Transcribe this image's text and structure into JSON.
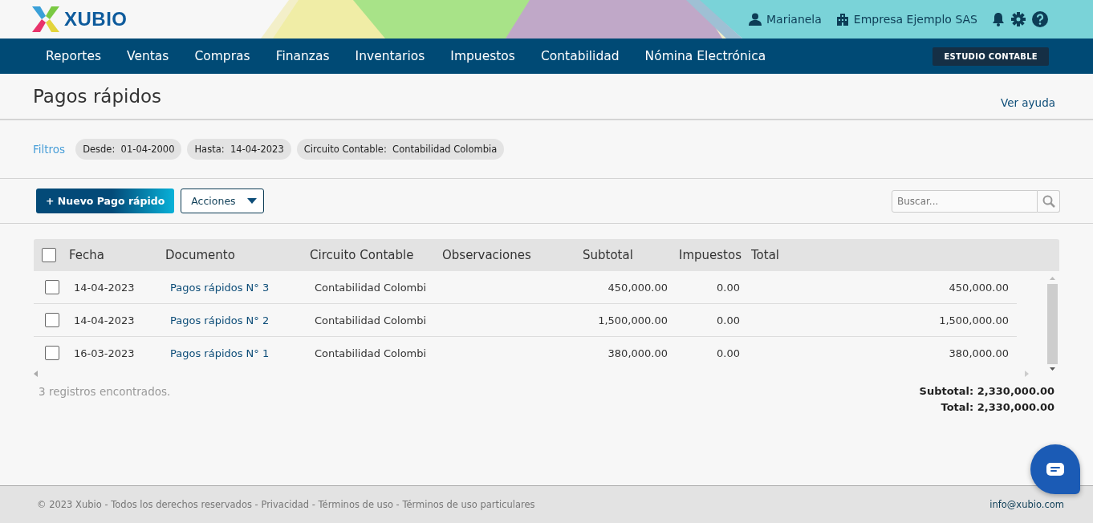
{
  "header": {
    "logo": "XUBIO",
    "user": "Marianela",
    "company": "Empresa Ejemplo SAS"
  },
  "nav": {
    "items": [
      "Reportes",
      "Ventas",
      "Compras",
      "Finanzas",
      "Inventarios",
      "Impuestos",
      "Contabilidad",
      "Nómina Electrónica"
    ],
    "badge": "ESTUDIO CONTABLE"
  },
  "page": {
    "title": "Pagos rápidos",
    "help_link": "Ver ayuda"
  },
  "filters": {
    "label": "Filtros",
    "chips": [
      {
        "name": "Desde:",
        "value": "01-04-2000"
      },
      {
        "name": "Hasta:",
        "value": "14-04-2023"
      },
      {
        "name": "Circuito Contable:",
        "value": "Contabilidad Colombia"
      }
    ]
  },
  "toolbar": {
    "new_button": "+ Nuevo Pago rápido",
    "actions_button": "Acciones",
    "search": {
      "placeholder": "Buscar..."
    }
  },
  "table": {
    "select_all_checked": false,
    "columns": [
      "Fecha",
      "Documento",
      "Circuito Contable",
      "Observaciones",
      "Subtotal",
      "Impuestos",
      "Total"
    ],
    "rows": [
      {
        "checked": false,
        "cells": [
          "14-04-2023",
          "Pagos rápidos N° 3",
          "Contabilidad Colombi",
          "",
          "450,000.00",
          "0.00",
          "450,000.00"
        ]
      },
      {
        "checked": false,
        "cells": [
          "14-04-2023",
          "Pagos rápidos N° 2",
          "Contabilidad Colombi",
          "",
          "1,500,000.00",
          "0.00",
          "1,500,000.00"
        ]
      },
      {
        "checked": false,
        "cells": [
          "16-03-2023",
          "Pagos rápidos N° 1",
          "Contabilidad Colombi",
          "",
          "380,000.00",
          "0.00",
          "380,000.00"
        ]
      }
    ]
  },
  "summary": {
    "count": "3 registros encontrados.",
    "subtotal": "Subtotal: 2,330,000.00",
    "total": "Total: 2,330,000.00"
  },
  "footer": {
    "copyright": "© 2023 Xubio - Todos los derechos reservados - Privacidad - Términos de uso - Términos de uso particulares",
    "email": "info@xubio.com"
  }
}
